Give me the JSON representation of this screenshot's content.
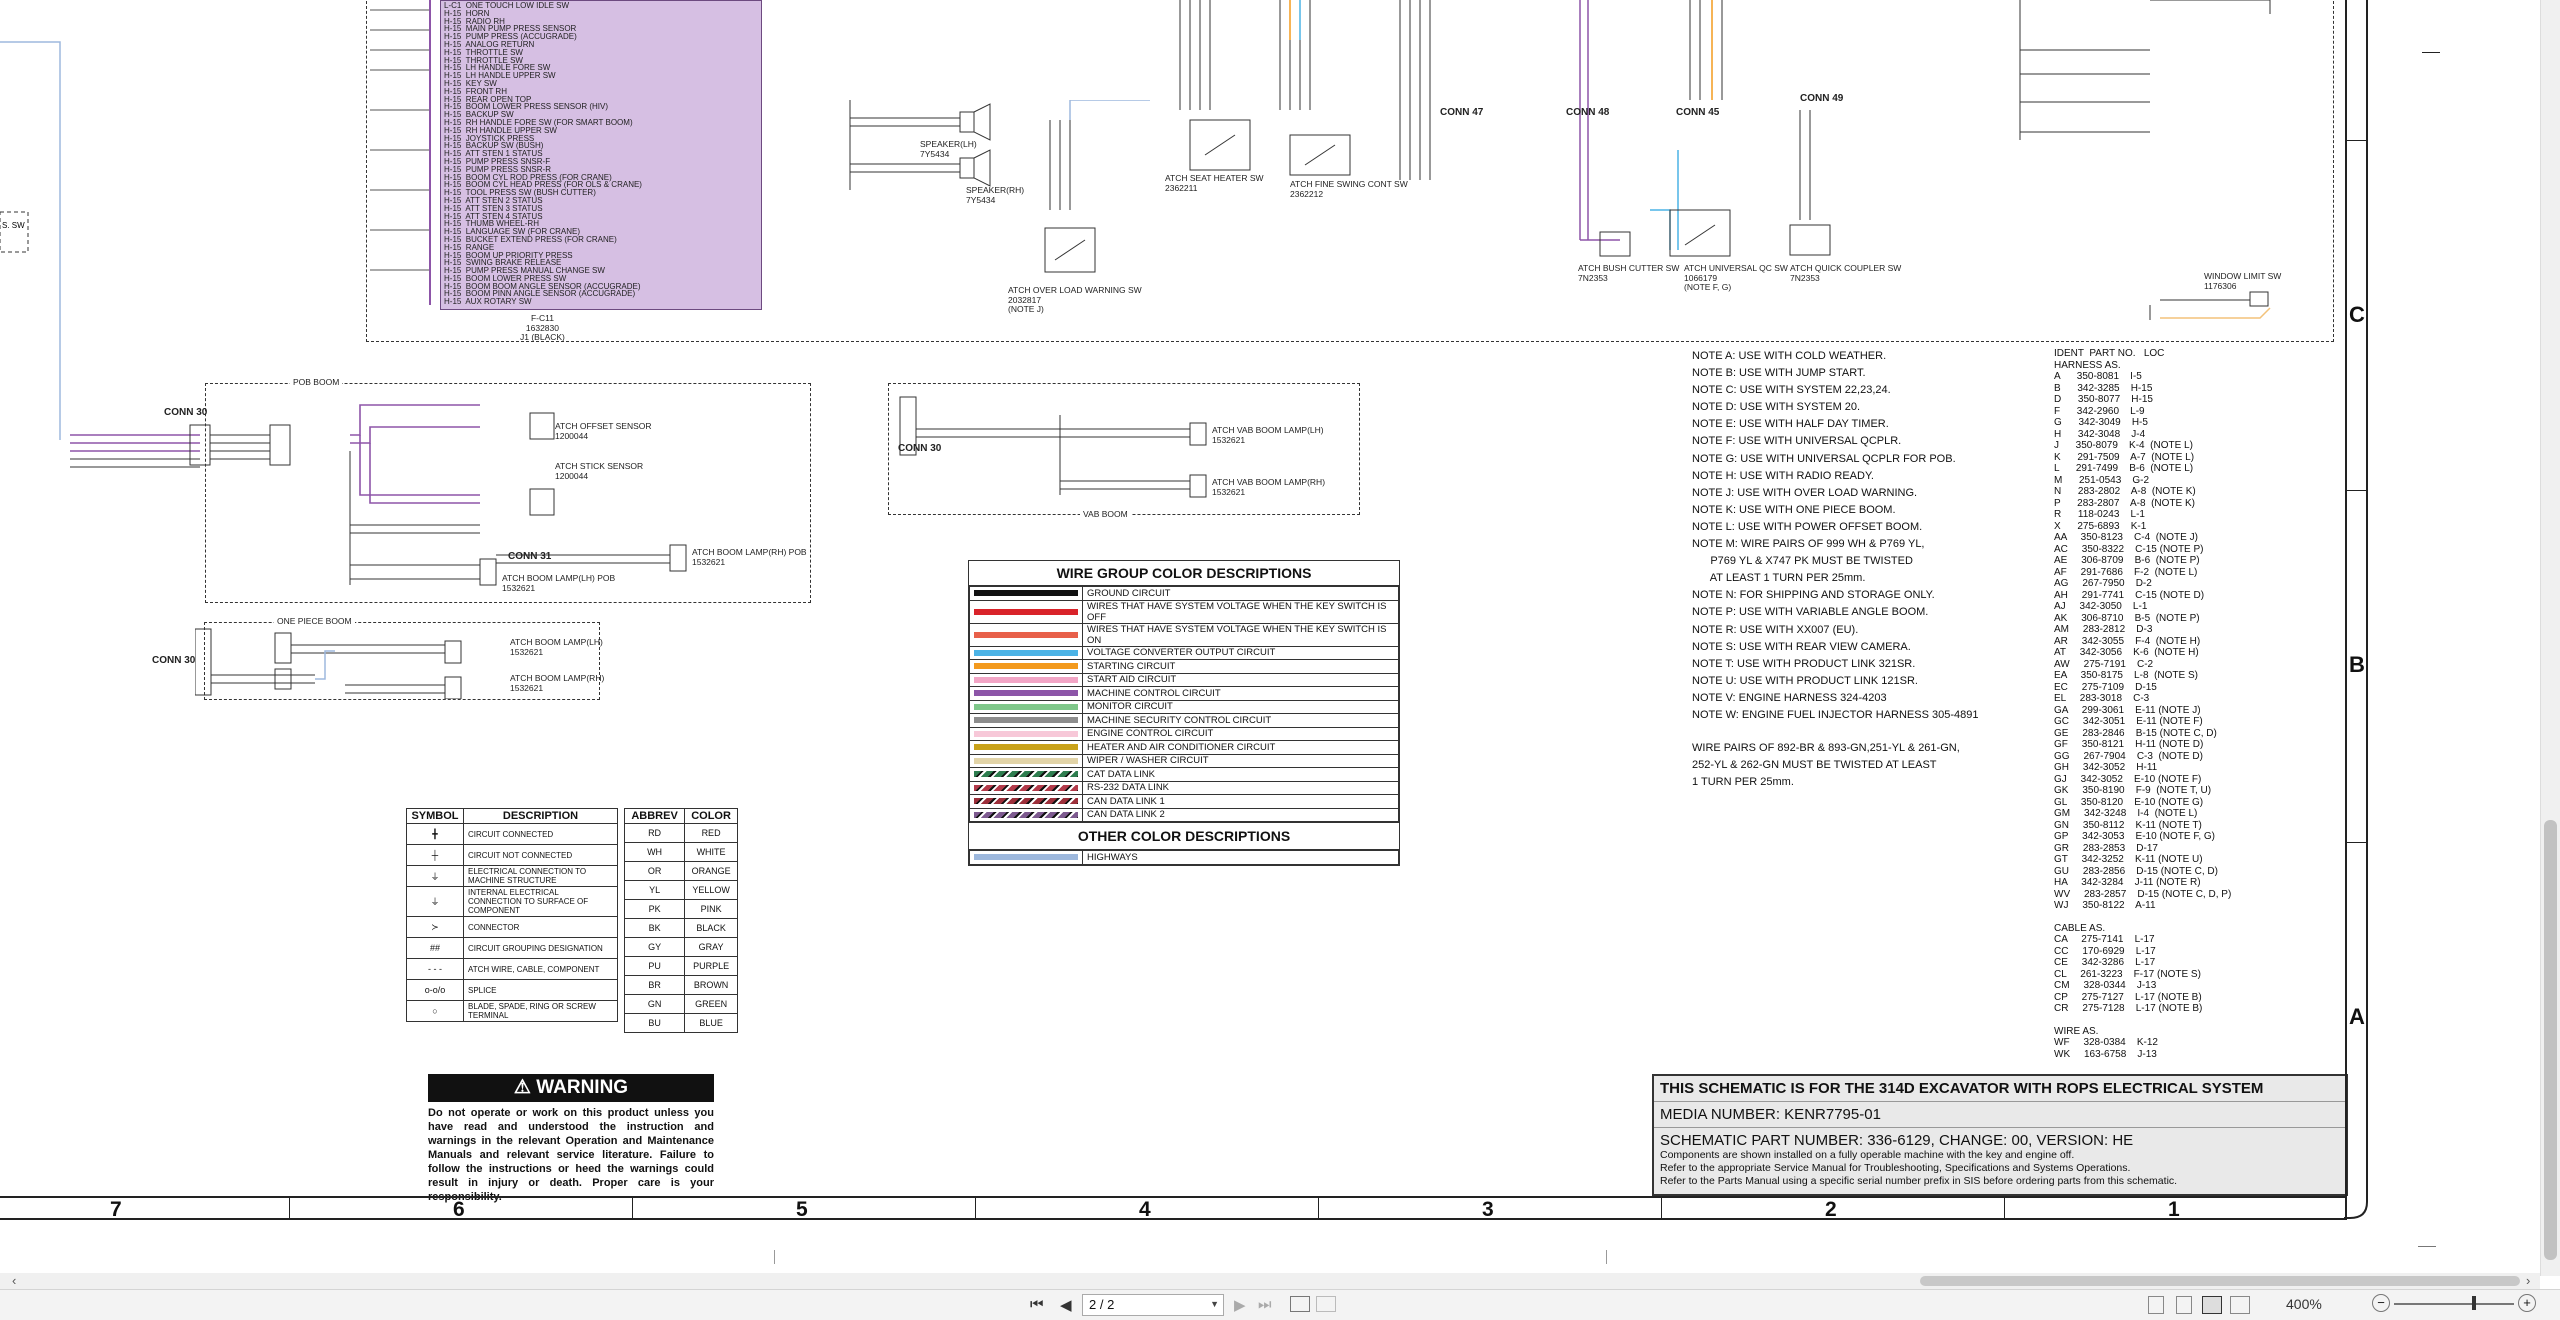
{
  "notes": [
    "NOTE A: USE WITH COLD WEATHER.",
    "NOTE B: USE WITH JUMP START.",
    "NOTE C: USE WITH SYSTEM 22,23,24.",
    "NOTE D: USE WITH SYSTEM 20.",
    "NOTE E: USE WITH HALF DAY TIMER.",
    "NOTE F: USE WITH UNIVERSAL QCPLR.",
    "NOTE G: USE WITH UNIVERSAL QCPLR FOR POB.",
    "NOTE H: USE WITH RADIO READY.",
    "NOTE J: USE WITH OVER LOAD WARNING.",
    "NOTE K: USE WITH ONE PIECE BOOM.",
    "NOTE L: USE WITH POWER OFFSET BOOM.",
    "NOTE M: WIRE PAIRS OF 999 WH & P769 YL,",
    "      P769 YL & X747 PK MUST BE TWISTED",
    "      AT LEAST 1 TURN PER 25mm.",
    "NOTE N: FOR SHIPPING AND STORAGE ONLY.",
    "NOTE P: USE WITH VARIABLE ANGLE BOOM.",
    "NOTE R: USE WITH XX007 (EU).",
    "NOTE S: USE WITH REAR VIEW CAMERA.",
    "NOTE T: USE WITH PRODUCT LINK 321SR.",
    "NOTE U: USE WITH PRODUCT LINK 121SR.",
    "NOTE V: ENGINE HARNESS 324-4203",
    "NOTE W: ENGINE FUEL INJECTOR HARNESS 305-4891"
  ],
  "twist_note": [
    "WIRE PAIRS OF 892-BR & 893-GN,251-YL & 261-GN,",
    "252-YL & 262-GN MUST BE TWISTED AT LEAST",
    "1 TURN PER 25mm."
  ],
  "ident": {
    "header": "IDENT  PART NO.   LOC",
    "harness_label": "HARNESS AS.",
    "rows": [
      "A      350-8081    I-5",
      "B      342-3285    H-15",
      "D      350-8077    H-15",
      "F      342-2960    L-9",
      "G      342-3049    H-5",
      "H      342-3048    J-4",
      "J      350-8079    K-4  (NOTE L)",
      "K      291-7509    A-7  (NOTE L)",
      "L      291-7499    B-6  (NOTE L)",
      "M      251-0543    G-2",
      "N      283-2802    A-8  (NOTE K)",
      "P      283-2807    A-8  (NOTE K)",
      "R      118-0243    L-1",
      "X      275-6893    K-1",
      "AA     350-8123    C-4  (NOTE J)",
      "AC     350-8322    C-15 (NOTE P)",
      "AE     306-8709    B-6  (NOTE P)",
      "AF     291-7686    F-2  (NOTE L)",
      "AG     267-7950    D-2",
      "AH     291-7741    C-15 (NOTE D)",
      "AJ     342-3050    L-1",
      "AK     306-8710    B-5  (NOTE P)",
      "AM     283-2812    D-3",
      "AR     342-3055    F-4  (NOTE H)",
      "AT     342-3056    K-6  (NOTE H)",
      "AW     275-7191    C-2",
      "EA     350-8175    L-8  (NOTE S)",
      "EC     275-7109    D-15",
      "EL     283-3018    C-3",
      "GA     299-3061    E-11 (NOTE J)",
      "GC     342-3051    E-11 (NOTE F)",
      "GE     283-2846    B-15 (NOTE C, D)",
      "GF     350-8121    H-11 (NOTE D)",
      "GG     267-7904    C-3  (NOTE D)",
      "GH     342-3052    H-11",
      "GJ     342-3052    E-10 (NOTE F)",
      "GK     350-8190    F-9  (NOTE T, U)",
      "GL     350-8120    E-10 (NOTE G)",
      "GM     342-3248    I-4  (NOTE L)",
      "GN     350-8112    K-11 (NOTE T)",
      "GP     342-3053    E-10 (NOTE F, G)",
      "GR     283-2853    D-17",
      "GT     342-3252    K-11 (NOTE U)",
      "GU     283-2856    D-15 (NOTE C, D)",
      "HA     342-3284    J-11 (NOTE R)",
      "WV     283-2857    D-15 (NOTE C, D, P)",
      "WJ     350-8122    A-11"
    ],
    "cable_label": "CABLE AS.",
    "cable_rows": [
      "CA     275-7141    L-17",
      "CC     170-6929    L-17",
      "CE     342-3286    L-17",
      "CL     261-3223    F-17 (NOTE S)",
      "CM     328-0344    J-13",
      "CP     275-7127    L-17 (NOTE B)",
      "CR     275-7128    L-17 (NOTE B)"
    ],
    "wire_label": "WIRE AS.",
    "wire_rows": [
      "WF     328-0384    K-12",
      "WK     163-6758    J-13"
    ]
  },
  "wire_group": {
    "title": "WIRE GROUP COLOR DESCRIPTIONS",
    "rows": [
      {
        "color": "#111111",
        "label": "GROUND CIRCUIT"
      },
      {
        "color": "#d9232a",
        "label": "WIRES THAT HAVE SYSTEM VOLTAGE WHEN THE KEY SWITCH IS OFF"
      },
      {
        "color": "#e8604a",
        "label": "WIRES THAT HAVE SYSTEM VOLTAGE WHEN THE KEY SWITCH IS ON"
      },
      {
        "color": "#4bb3e6",
        "label": "VOLTAGE CONVERTER OUTPUT CIRCUIT"
      },
      {
        "color": "#f39a1e",
        "label": "STARTING CIRCUIT"
      },
      {
        "color": "#f2a5c5",
        "label": "START AID CIRCUIT"
      },
      {
        "color": "#8d55a8",
        "label": "MACHINE CONTROL CIRCUIT"
      },
      {
        "color": "#7fc78a",
        "label": "MONITOR CIRCUIT"
      },
      {
        "color": "#8d8d8d",
        "label": "MACHINE SECURITY CONTROL CIRCUIT"
      },
      {
        "color": "#f7c8d8",
        "label": "ENGINE CONTROL CIRCUIT"
      },
      {
        "color": "#c9a21a",
        "label": "HEATER AND AIR CONDITIONER CIRCUIT"
      },
      {
        "color": "#e2d4a8",
        "label": "WIPER / WASHER CIRCUIT"
      },
      {
        "color": "#2e7d4f",
        "label": "CAT DATA LINK",
        "striped": true
      },
      {
        "color": "#b23a4a",
        "label": "RS-232 DATA LINK",
        "striped": true
      },
      {
        "color": "#9c2f3a",
        "label": "CAN DATA LINK 1",
        "striped": true
      },
      {
        "color": "#7d5a8f",
        "label": "CAN DATA LINK 2",
        "striped": true
      }
    ],
    "other_title": "OTHER COLOR DESCRIPTIONS",
    "other_rows": [
      {
        "color": "#9db8dd",
        "label": "HIGHWAYS"
      }
    ]
  },
  "symbols": {
    "h1": "SYMBOL",
    "h2": "DESCRIPTION",
    "rows": [
      {
        "sym": "╋",
        "desc": "CIRCUIT CONNECTED"
      },
      {
        "sym": "┼",
        "desc": "CIRCUIT NOT CONNECTED"
      },
      {
        "sym": "⏚",
        "desc": "ELECTRICAL CONNECTION TO MACHINE STRUCTURE"
      },
      {
        "sym": "⏚",
        "desc": "INTERNAL ELECTRICAL CONNECTION TO SURFACE OF COMPONENT"
      },
      {
        "sym": "≻",
        "desc": "CONNECTOR"
      },
      {
        "sym": "##",
        "desc": "CIRCUIT GROUPING DESIGNATION"
      },
      {
        "sym": "- - -",
        "desc": "ATCH WIRE, CABLE, COMPONENT"
      },
      {
        "sym": "o-o/o",
        "desc": "SPLICE"
      },
      {
        "sym": "○",
        "desc": "BLADE, SPADE, RING OR SCREW TERMINAL"
      }
    ]
  },
  "abbrev": {
    "h1": "ABBREV",
    "h2": "COLOR",
    "rows": [
      [
        "RD",
        "RED"
      ],
      [
        "WH",
        "WHITE"
      ],
      [
        "OR",
        "ORANGE"
      ],
      [
        "YL",
        "YELLOW"
      ],
      [
        "PK",
        "PINK"
      ],
      [
        "BK",
        "BLACK"
      ],
      [
        "GY",
        "GRAY"
      ],
      [
        "PU",
        "PURPLE"
      ],
      [
        "BR",
        "BROWN"
      ],
      [
        "GN",
        "GREEN"
      ],
      [
        "BU",
        "BLUE"
      ]
    ]
  },
  "warning": {
    "title": "WARNING",
    "body": "Do not operate or work on this product unless you have read and understood the instruction and warnings in the relevant Operation and Maintenance Manuals and relevant service literature. Failure to follow the instructions or heed the warnings could result in injury or death. Proper care is your responsibility."
  },
  "titleblock": {
    "line1": "THIS SCHEMATIC IS FOR THE 314D EXCAVATOR WITH ROPS ELECTRICAL SYSTEM",
    "line2": "MEDIA NUMBER: KENR7795-01",
    "line3": "SCHEMATIC PART NUMBER: 336-6129, CHANGE: 00, VERSION: HE",
    "line4": "Components are shown installed on a fully operable machine with the key and engine off.",
    "line5": "Refer to the appropriate Service Manual for Troubleshooting, Specifications and Systems Operations.",
    "line6": "Refer to the Parts Manual using a specific serial number prefix in SIS before ordering parts from this schematic."
  },
  "zones_cols": [
    "7",
    "6",
    "5",
    "4",
    "3",
    "2",
    "1"
  ],
  "zones_rows": [
    "C",
    "B",
    "A"
  ],
  "schematic_labels": {
    "pob_boom": "POB BOOM",
    "vab_boom": "VAB BOOM",
    "one_piece_boom": "ONE PIECE BOOM",
    "conn30a": "CONN 30",
    "conn30b": "CONN 30",
    "conn30c": "CONN 30",
    "conn31": "CONN 31",
    "conn47": "CONN 47",
    "conn48": "CONN 48",
    "conn49": "CONN 49",
    "conn45": "CONN 45",
    "offset_sensor": "ATCH OFFSET SENSOR\n1200044",
    "stick_sensor": "ATCH STICK SENSOR\n1200044",
    "boom_lamp_lh_pob": "ATCH BOOM LAMP(LH) POB\n1532621",
    "boom_lamp_rh_pob": "ATCH BOOM LAMP(RH) POB\n1532621",
    "vab_lamp_lh": "ATCH VAB BOOM LAMP(LH)\n1532621",
    "vab_lamp_rh": "ATCH VAB BOOM LAMP(RH)\n1532621",
    "boom_lamp_lh": "ATCH BOOM LAMP(LH)\n1532621",
    "boom_lamp_rh": "ATCH BOOM LAMP(RH)\n1532621",
    "speaker_lh": "SPEAKER(LH)\n7Y5434",
    "speaker_rh": "SPEAKER(RH)\n7Y5434",
    "over_load": "ATCH OVER LOAD WARNING SW\n2032817\n(NOTE J)",
    "seat_heater": "ATCH SEAT HEATER SW\n2362211",
    "fine_swing": "ATCH FINE SWING CONT SW\n2362212",
    "bush_cutter": "ATCH BUSH CUTTER SW\n7N2353",
    "universal_qc": "ATCH UNIVERSAL QC SW\n1066179\n(NOTE F, G)",
    "quick_coupler": "ATCH QUICK COUPLER SW\n7N2353",
    "window_limit": "WINDOW LIMIT SW\n1176306",
    "j1_black": "F-C11\n1632830\nJ1 (BLACK)"
  },
  "connector_block": [
    "L-C1  ONE TOUCH LOW IDLE SW",
    "H-15  HORN",
    "H-15  RADIO RH",
    "H-15  MAIN PUMP PRESS SENSOR",
    "H-15  PUMP PRESS (ACCUGRADE)",
    "H-15  ANALOG RETURN",
    "H-15  THROTTLE SW",
    "H-15  THROTTLE SW",
    "H-15  LH HANDLE FORE SW",
    "H-15  LH HANDLE UPPER SW",
    "H-15  KEY SW",
    "H-15  FRONT RH",
    "H-15  REAR OPEN TOP",
    "H-15  BOOM LOWER PRESS SENSOR (HIV)",
    "H-15  BACKUP SW",
    "H-15  RH HANDLE FORE SW (FOR SMART BOOM)",
    "H-15  RH HANDLE UPPER SW",
    "H-15  JOYSTICK PRESS",
    "H-15  BACKUP SW (BUSH)",
    "H-15  ATT STEN 1 STATUS",
    "H-15  PUMP PRESS SNSR-F",
    "H-15  PUMP PRESS SNSR-R",
    "H-15  BOOM CYL ROD PRESS (FOR CRANE)",
    "H-15  BOOM CYL HEAD PRESS (FOR OLS & CRANE)",
    "H-15  TOOL PRESS SW (BUSH CUTTER)",
    "H-15  ATT STEN 2 STATUS",
    "H-15  ATT STEN 3 STATUS",
    "H-15  ATT STEN 4 STATUS",
    "H-15  THUMB WHEEL-RH",
    "H-15  LANGUAGE SW (FOR CRANE)",
    "H-15  BUCKET EXTEND PRESS (FOR CRANE)",
    "H-15  RANGE",
    "H-15  BOOM UP PRIORITY PRESS",
    "H-15  SWING BRAKE RELEASE",
    "H-15  PUMP PRESS MANUAL CHANGE SW",
    "H-15  BOOM LOWER PRESS SW",
    "H-15  BOOM BOOM ANGLE SENSOR (ACCUGRADE)",
    "H-15  BOOM PINN ANGLE SENSOR (ACCUGRADE)",
    "H-15  AUX ROTARY SW"
  ],
  "viewer": {
    "page_value": "2 / 2",
    "zoom": "400%",
    "first": "⏮",
    "prev": "◀",
    "next": "▶",
    "last": "⏭"
  }
}
